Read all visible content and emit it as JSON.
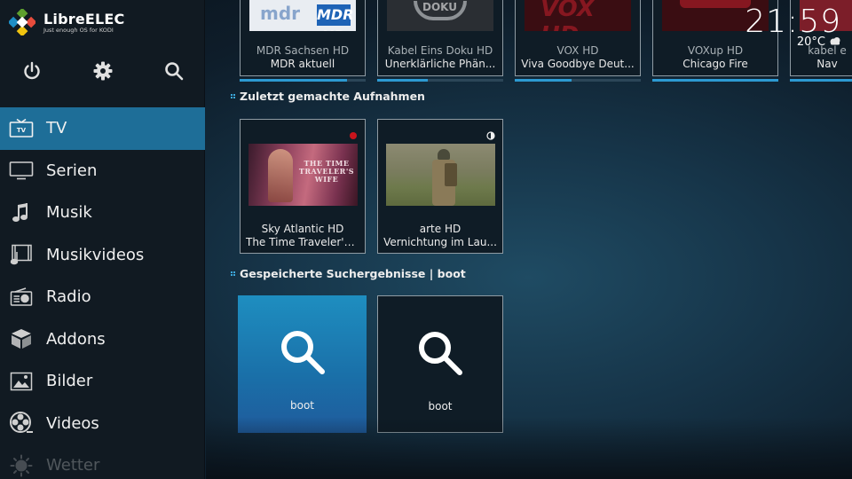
{
  "brand": {
    "name": "LibreELEC",
    "tagline": "Just enough OS for KODI"
  },
  "clock": {
    "time": "21:59",
    "temperature": "20°C",
    "weather_icon": "cloud-icon"
  },
  "sidebar": {
    "top_icons": [
      "power-icon",
      "gear-icon",
      "search-icon"
    ],
    "items": [
      {
        "label": "TV",
        "icon": "tv-icon"
      },
      {
        "label": "Serien",
        "icon": "monitor-icon"
      },
      {
        "label": "Musik",
        "icon": "music-note-icon"
      },
      {
        "label": "Musikvideos",
        "icon": "music-video-icon"
      },
      {
        "label": "Radio",
        "icon": "radio-icon"
      },
      {
        "label": "Addons",
        "icon": "box-icon"
      },
      {
        "label": "Bilder",
        "icon": "picture-icon"
      },
      {
        "label": "Videos",
        "icon": "film-reel-icon"
      },
      {
        "label": "Wetter",
        "icon": "sun-icon"
      }
    ],
    "active": "TV"
  },
  "channels": [
    {
      "channel": "MDR Sachsen HD",
      "program": "MDR aktuell",
      "logo": "MDR HD",
      "progress": 0.85
    },
    {
      "channel": "Kabel Eins Doku HD",
      "program": "Unerklärliche Phän...",
      "logo": "DOKU",
      "progress": 0.4
    },
    {
      "channel": "VOX HD",
      "program": "Viva Goodbye Deut...",
      "logo": "VOX HD",
      "progress": 0.45
    },
    {
      "channel": "VOXup HD",
      "program": "Chicago Fire",
      "logo": "",
      "progress": 1.0
    },
    {
      "channel": "kabel e",
      "program": "Nav",
      "logo": "",
      "progress": 1.0
    }
  ],
  "recordings": {
    "title": "Zuletzt gemachte Aufnahmen",
    "items": [
      {
        "channel": "Sky Atlantic HD",
        "program": "The Time Traveler's...",
        "poster_text": "THE TIME TRAVELER'S WIFE",
        "status": "recording"
      },
      {
        "channel": "arte HD",
        "program": "Vernichtung im Lau...",
        "status": "partial"
      }
    ]
  },
  "saved_searches": {
    "title": "Gespeicherte Suchergebnisse | boot",
    "items": [
      {
        "label": "boot"
      },
      {
        "label": "boot"
      }
    ]
  }
}
